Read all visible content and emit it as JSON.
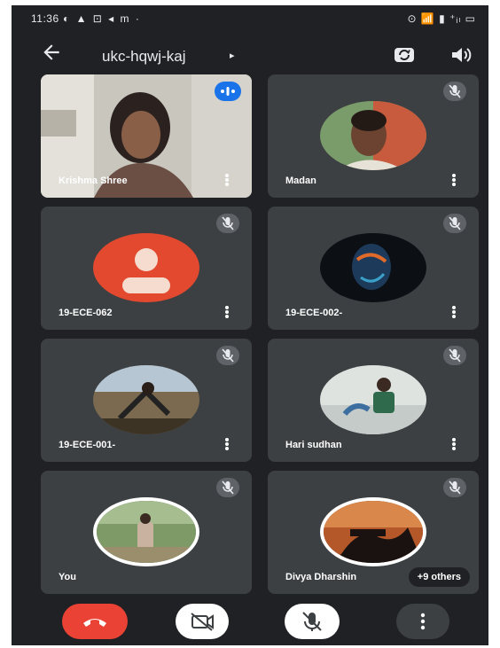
{
  "status_bar": {
    "time": "11:36",
    "left_icons": "◐ ▲ ⊡ ◂ m ·",
    "right_icons": "⊙ 📶 ▮ ⁺ᵢₗ ▭"
  },
  "top_bar": {
    "meeting_code": "ukc-hqwj-kaj",
    "caret": "▸"
  },
  "participants": [
    {
      "name": "Krishma Shree",
      "type": "video",
      "speaking": true
    },
    {
      "name": "Madan",
      "type": "photo",
      "muted": true
    },
    {
      "name": "19-ECE-062",
      "type": "initial-avatar",
      "muted": true
    },
    {
      "name": "19-ECE-002-",
      "type": "photo",
      "muted": true
    },
    {
      "name": "19-ECE-001-",
      "type": "photo",
      "muted": true
    },
    {
      "name": "Hari sudhan",
      "type": "photo",
      "muted": true
    },
    {
      "name": "You",
      "type": "photo",
      "muted": true
    },
    {
      "name": "Divya Dharshin",
      "type": "photo",
      "muted": true
    }
  ],
  "others_badge": "+9 others",
  "colors": {
    "background": "#202124",
    "tile": "#3c4043",
    "end_call": "#ea4335",
    "speaking": "#1a73e8",
    "avatar_orange": "#e2492f"
  }
}
